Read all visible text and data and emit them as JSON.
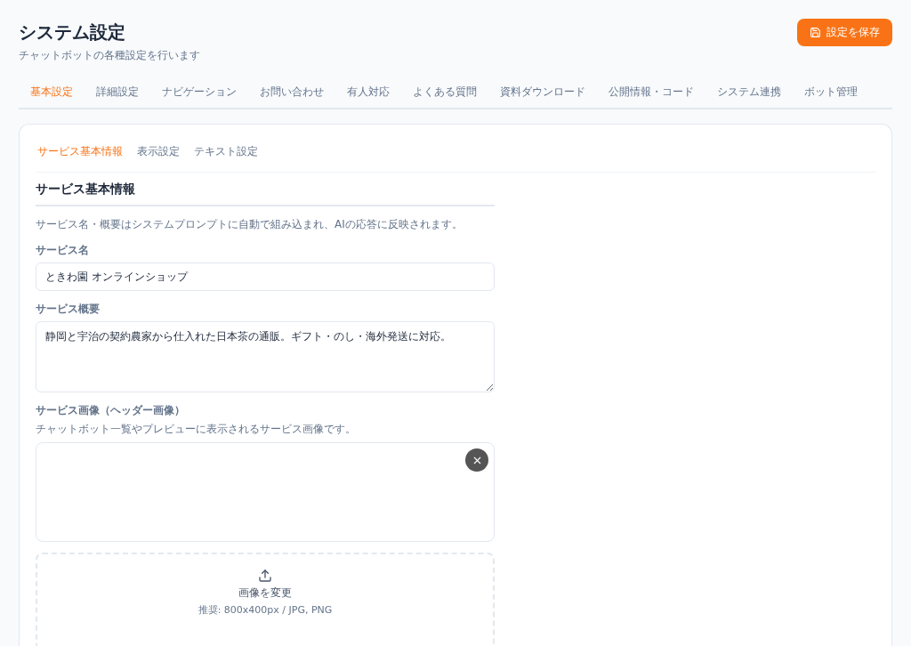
{
  "header": {
    "title": "システム設定",
    "subtitle": "チャットボットの各種設定を行います",
    "save_button": "設定を保存"
  },
  "tabs": [
    {
      "label": "基本設定",
      "selected": true
    },
    {
      "label": "詳細設定",
      "selected": false
    },
    {
      "label": "ナビゲーション",
      "selected": false
    },
    {
      "label": "お問い合わせ",
      "selected": false
    },
    {
      "label": "有人対応",
      "selected": false
    },
    {
      "label": "よくある質問",
      "selected": false
    },
    {
      "label": "資料ダウンロード",
      "selected": false
    },
    {
      "label": "公開情報・コード",
      "selected": false
    },
    {
      "label": "システム連携",
      "selected": false
    },
    {
      "label": "ボット管理",
      "selected": false
    }
  ],
  "subtabs": [
    {
      "label": "サービス基本情報",
      "selected": true
    },
    {
      "label": "表示設定",
      "selected": false
    },
    {
      "label": "テキスト設定",
      "selected": false
    }
  ],
  "section": {
    "title": "サービス基本情報",
    "note": "サービス名・概要はシステムプロンプトに自動で組み込まれ、AIの応答に反映されます。",
    "service_name": {
      "label": "サービス名",
      "value": "ときわ園 オンラインショップ"
    },
    "service_summary": {
      "label": "サービス概要",
      "value": "静岡と宇治の契約農家から仕入れた日本茶の通販。ギフト・のし・海外発送に対応。"
    },
    "service_image": {
      "label": "サービス画像（ヘッダー画像）",
      "hint": "チャットボット一覧やプレビューに表示されるサービス画像です。",
      "upload_label": "画像を変更",
      "upload_hint": "推奨: 800x400px / JPG, PNG"
    }
  }
}
